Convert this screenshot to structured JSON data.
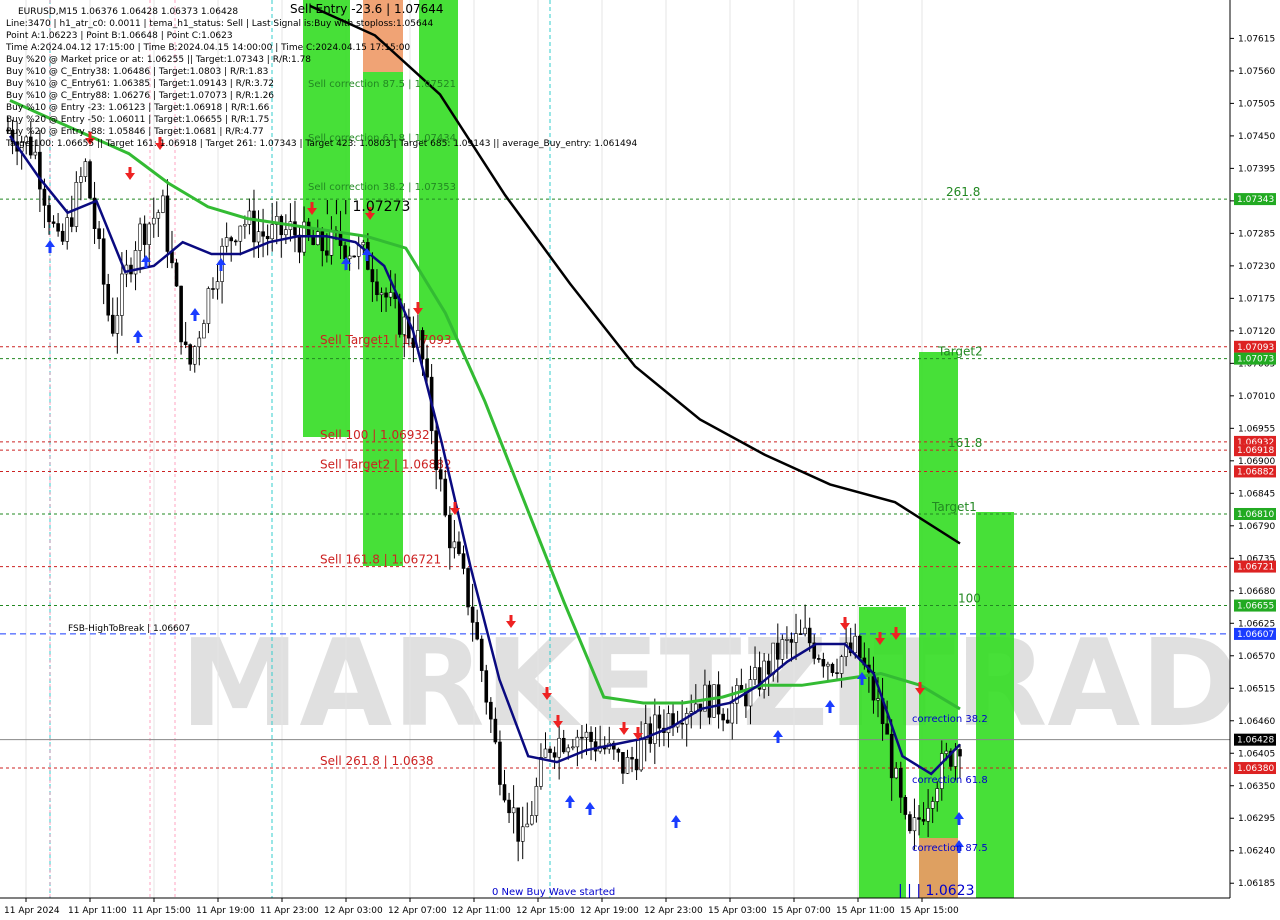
{
  "header": {
    "symbol_line": "EURUSD,M15  1.06376 1.06428 1.06373 1.06428",
    "info_lines": [
      "Line:3470  | h1_atr_c0: 0.0011  |  tema_h1_status: Sell  |  Last Signal is:Buy with stoploss:1.05644",
      "Point A:1.06223  |  Point B:1.06648  |  Point C:1.0623",
      "Time A:2024.04.12 17:15:00  |  Time B:2024.04.15 14:00:00  |  Time C:2024.04.15 17:15:00",
      "Buy %20 @ Market price or at: 1.06255  ||  Target:1.07343  |  R/R:1.78",
      "Buy %10 @ C_Entry38: 1.06486  |  Target:1.0803  |  R/R:1.83",
      "Buy %10 @ C_Entry61: 1.06385  |  Target:1.09143  |  R/R:3.72",
      "Buy %10 @ C_Entry88: 1.06276  |  Target:1.07073  |  R/R:1.26",
      "Buy %10 @ Entry -23: 1.06123  |  Target:1.06918  |  R/R:1.66",
      "Buy %20 @ Entry -50: 1.06011  |  Target:1.06655  |  R/R:1.75",
      "Buy %20 @ Entry -88: 1.05846  |  Target:1.0681  |  R/R:4.77",
      "Target100: 1.06655  ||  Target 161: 1.06918  |  Target 261: 1.07343  |  Target 423: 1.0803  |  Target 685: 1.09143  ||  average_Buy_entry: 1.061494"
    ]
  },
  "watermark": "MARKETZITRADE",
  "chart_data": {
    "type": "line",
    "title": "EURUSD,M15",
    "ylim": [
      1.0616,
      1.0768
    ],
    "y_ticks": [
      "1.07615",
      "1.07560",
      "1.07505",
      "1.07450",
      "1.07395",
      "1.07340",
      "1.07285",
      "1.07230",
      "1.07175",
      "1.07120",
      "1.07065",
      "1.07010",
      "1.06955",
      "1.06900",
      "1.06845",
      "1.06790",
      "1.06735",
      "1.06680",
      "1.06625",
      "1.06570",
      "1.06515",
      "1.06460",
      "1.06405",
      "1.06350",
      "1.06295",
      "1.06240",
      "1.06185"
    ],
    "x_ticks": [
      "11 Apr 2024",
      "11 Apr 11:00",
      "11 Apr 15:00",
      "11 Apr 19:00",
      "11 Apr 23:00",
      "12 Apr 03:00",
      "12 Apr 07:00",
      "12 Apr 11:00",
      "12 Apr 15:00",
      "12 Apr 19:00",
      "12 Apr 23:00",
      "15 Apr 03:00",
      "15 Apr 07:00",
      "15 Apr 11:00",
      "15 Apr 15:00"
    ],
    "price_tags": [
      {
        "value": 1.07343,
        "label": "1.07343",
        "color": "#22aa22"
      },
      {
        "value": 1.07093,
        "label": "1.07093",
        "color": "#dd2222"
      },
      {
        "value": 1.07073,
        "label": "1.07073",
        "color": "#22aa22"
      },
      {
        "value": 1.06932,
        "label": "1.06932",
        "color": "#dd2222"
      },
      {
        "value": 1.06918,
        "label": "1.06918",
        "color": "#dd2222"
      },
      {
        "value": 1.06882,
        "label": "1.06882",
        "color": "#dd2222"
      },
      {
        "value": 1.0681,
        "label": "1.06810",
        "color": "#22aa22"
      },
      {
        "value": 1.06721,
        "label": "1.06721",
        "color": "#dd2222"
      },
      {
        "value": 1.06655,
        "label": "1.06655",
        "color": "#22aa22"
      },
      {
        "value": 1.06607,
        "label": "1.06607",
        "color": "#1a3cff"
      },
      {
        "value": 1.06428,
        "label": "1.06428",
        "color": "#000000"
      },
      {
        "value": 1.0638,
        "label": "1.06380",
        "color": "#dd2222"
      }
    ],
    "levels": [
      {
        "value": 1.07343,
        "style": "green-dash",
        "label": "261.8",
        "label_color": "#228822"
      },
      {
        "value": 1.07093,
        "style": "red-dash",
        "label": "Sell Target1 | 1.07093",
        "label_color": "#cc2222"
      },
      {
        "value": 1.07073,
        "style": "green-dash",
        "label": "Target2",
        "label_color": "#228822"
      },
      {
        "value": 1.06932,
        "style": "red-dash",
        "label": "Sell 100 | 1.06932",
        "label_color": "#cc2222"
      },
      {
        "value": 1.06918,
        "style": "red-dash",
        "label": "161.8",
        "label_color": "#228822"
      },
      {
        "value": 1.06882,
        "style": "red-dash",
        "label": "Sell Target2 | 1.06882",
        "label_color": "#cc2222"
      },
      {
        "value": 1.0681,
        "style": "green-dash",
        "label": "Target1",
        "label_color": "#228822"
      },
      {
        "value": 1.06721,
        "style": "red-dash",
        "label": "Sell 161.8 | 1.06721",
        "label_color": "#cc2222"
      },
      {
        "value": 1.06655,
        "style": "green-dash",
        "label": "100",
        "label_color": "#228822"
      },
      {
        "value": 1.06607,
        "style": "blue-dash",
        "label": "FSB-HighToBreak | 1.06607",
        "label_color": "#000000"
      },
      {
        "value": 1.06428,
        "style": "gray-solid",
        "label": "",
        "label_color": "#000000"
      },
      {
        "value": 1.0638,
        "style": "red-dash",
        "label": "Sell 261.8 | 1.0638",
        "label_color": "#cc2222"
      }
    ],
    "annotations": [
      "Sell Entry -23.6 | 1.07644",
      "Sell correction 87.5 | 1.07521",
      "Sell correction 61.8 | 1.07434",
      "Sell correction 38.2 | 1.07353",
      "| | | 1.07273",
      "0 New Buy Wave started",
      "correction 38.2",
      "correction 61.8",
      "correction 87.5",
      "| | | 1.0623"
    ],
    "series": [
      {
        "name": "EURUSD close",
        "values": [
          1.0746,
          1.0743,
          1.0725,
          1.074,
          1.0712,
          1.0728,
          1.0733,
          1.0705,
          1.0722,
          1.0731,
          1.0728,
          1.0729,
          1.0726,
          1.0727,
          1.0724,
          1.0715,
          1.071,
          1.068,
          1.0665,
          1.064,
          1.0625,
          1.0642,
          1.0644,
          1.0642,
          1.0638,
          1.0644,
          1.0648,
          1.065,
          1.0648,
          1.0652,
          1.0658,
          1.066,
          1.0656,
          1.0658,
          1.0646,
          1.0625,
          1.0636,
          1.0643
        ]
      },
      {
        "name": "MA fast",
        "values": [
          1.0745,
          1.0738,
          1.0732,
          1.0734,
          1.0722,
          1.0723,
          1.0727,
          1.0725,
          1.0725,
          1.0727,
          1.0728,
          1.0728,
          1.0727,
          1.0723,
          1.0712,
          1.0693,
          1.0672,
          1.0653,
          1.064,
          1.0639,
          1.0641,
          1.0642,
          1.0643,
          1.0645,
          1.0648,
          1.0649,
          1.0652,
          1.0656,
          1.0659,
          1.0659,
          1.0654,
          1.064,
          1.0637,
          1.0642
        ]
      },
      {
        "name": "MA slow",
        "values": [
          1.0751,
          1.0748,
          1.0745,
          1.0742,
          1.0737,
          1.0733,
          1.0731,
          1.073,
          1.0729,
          1.0728,
          1.0726,
          1.0715,
          1.07,
          1.0683,
          1.0666,
          1.065,
          1.0649,
          1.0649,
          1.065,
          1.0652,
          1.0652,
          1.0653,
          1.0654,
          1.0652,
          1.0648
        ]
      },
      {
        "name": "MA long",
        "values": [
          1.0767,
          1.0762,
          1.0752,
          1.0735,
          1.072,
          1.0706,
          1.0697,
          1.0691,
          1.0686,
          1.0683,
          1.0676
        ]
      }
    ]
  },
  "colors": {
    "green_zone": "#33dd22",
    "salmon_zone": "#ee9966",
    "candle": "#000000",
    "ma_fast": "#0a0a80",
    "ma_slow": "#33bb33",
    "ma_long": "#000000",
    "cyan_vline": "#33cccc",
    "pink_vline": "#ff6699"
  }
}
